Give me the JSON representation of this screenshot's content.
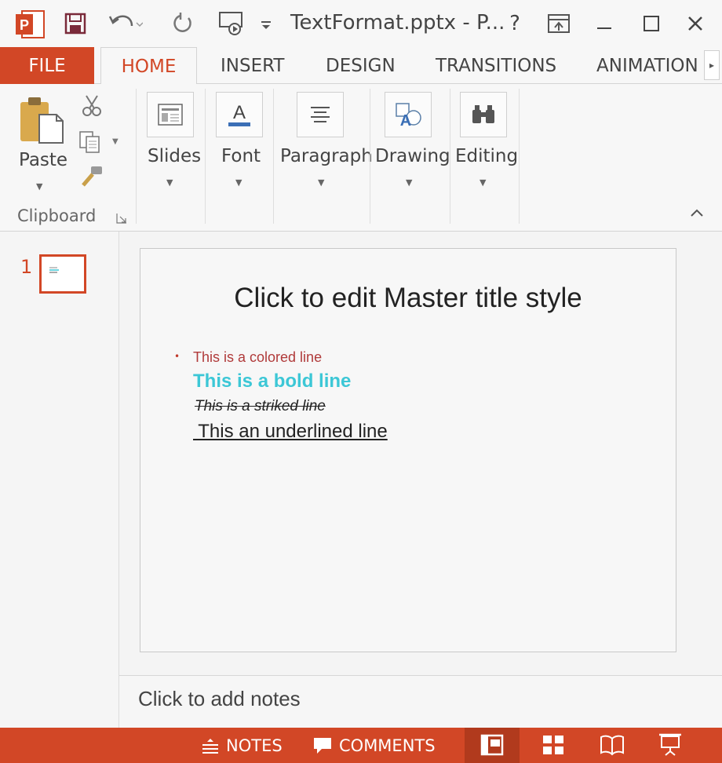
{
  "window": {
    "title": "TextFormat.pptx - P...",
    "help_label": "?",
    "brand_color": "#d24726"
  },
  "quick_access": {
    "icons": [
      "powerpoint-logo-icon",
      "save-icon",
      "undo-icon",
      "redo-icon",
      "start-from-beginning-icon",
      "customize-dropdown-icon"
    ]
  },
  "tabs": {
    "file": "FILE",
    "home": "HOME",
    "insert": "INSERT",
    "design": "DESIGN",
    "transitions": "TRANSITIONS",
    "animations": "ANIMATION"
  },
  "ribbon": {
    "paste_label": "Paste",
    "clipboard_label": "Clipboard",
    "groups": {
      "slides": "Slides",
      "font": "Font",
      "paragraph": "Paragraph",
      "drawing": "Drawing",
      "editing": "Editing"
    }
  },
  "thumbnails": {
    "slide_number": "1"
  },
  "slide": {
    "title": "Click to edit Master title style",
    "bullet": "•",
    "lines": {
      "colored": "This is a colored line",
      "bold": "This is a bold line",
      "striked": "This is a striked line",
      "underlined": " This an underlined line"
    },
    "colors": {
      "colored_line": "#b03a3a",
      "bold_line": "#3cc7d6"
    }
  },
  "notes": {
    "placeholder": "Click to add notes"
  },
  "statusbar": {
    "notes": "NOTES",
    "comments": "COMMENTS"
  }
}
